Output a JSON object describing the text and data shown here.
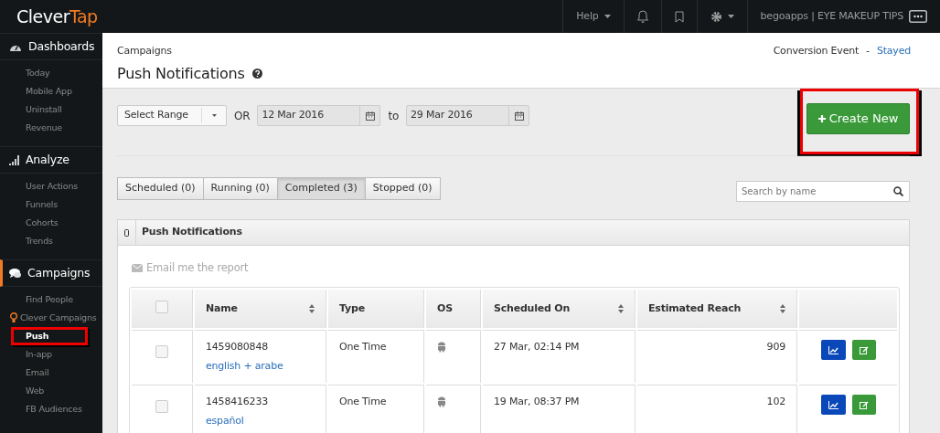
{
  "topbar": {
    "logo_first": "Clever",
    "logo_second": "Tap",
    "help": "Help",
    "account": "begoapps | EYE MAKEUP TIPS"
  },
  "sidebar": {
    "sections": [
      {
        "title": "Dashboards",
        "kind": "dashboard",
        "active": false,
        "items": [
          {
            "label": "Today",
            "kind": "plain",
            "selected": false,
            "highlighted": false
          },
          {
            "label": "Mobile App",
            "kind": "plain",
            "selected": false,
            "highlighted": false
          },
          {
            "label": "Uninstall",
            "kind": "plain",
            "selected": false,
            "highlighted": false
          },
          {
            "label": "Revenue",
            "kind": "plain",
            "selected": false,
            "highlighted": false
          }
        ]
      },
      {
        "title": "Analyze",
        "kind": "signal",
        "active": false,
        "items": [
          {
            "label": "User Actions",
            "kind": "plain",
            "selected": false,
            "highlighted": false
          },
          {
            "label": "Funnels",
            "kind": "plain",
            "selected": false,
            "highlighted": false
          },
          {
            "label": "Cohorts",
            "kind": "plain",
            "selected": false,
            "highlighted": false
          },
          {
            "label": "Trends",
            "kind": "plain",
            "selected": false,
            "highlighted": false
          }
        ]
      },
      {
        "title": "Campaigns",
        "kind": "chat",
        "active": true,
        "items": [
          {
            "label": "Find People",
            "kind": "plain",
            "selected": false,
            "highlighted": false
          },
          {
            "label": "Clever Campaigns",
            "kind": "bulb",
            "selected": false,
            "highlighted": false
          },
          {
            "label": "Push",
            "kind": "plain",
            "selected": true,
            "highlighted": true
          },
          {
            "label": "In-app",
            "kind": "plain",
            "selected": false,
            "highlighted": false
          },
          {
            "label": "Email",
            "kind": "plain",
            "selected": false,
            "highlighted": false
          },
          {
            "label": "Web",
            "kind": "plain",
            "selected": false,
            "highlighted": false
          },
          {
            "label": "FB Audiences",
            "kind": "plain",
            "selected": false,
            "highlighted": false
          }
        ]
      }
    ]
  },
  "header": {
    "breadcrumb": "Campaigns",
    "title": "Push Notifications",
    "conversion_label": "Conversion Event",
    "separator": "-",
    "conversion_value": "Stayed"
  },
  "filters": {
    "range": "Select Range",
    "or_label": "OR",
    "from": "12 Mar 2016",
    "to_label": "to",
    "to": "29 Mar 2016"
  },
  "create_button": {
    "label": "Create New",
    "highlighted": true
  },
  "tabs": [
    {
      "label": "Scheduled (0)",
      "selected": false
    },
    {
      "label": "Running (0)",
      "selected": false
    },
    {
      "label": "Completed (3)",
      "selected": true
    },
    {
      "label": "Stopped (0)",
      "selected": false
    }
  ],
  "search": {
    "placeholder": "Search by name"
  },
  "panel": {
    "title": "Push Notifications",
    "email_link": "Email me the report"
  },
  "table": {
    "select_all_checked": false,
    "columns": [
      {
        "label": "Name",
        "sortable": true
      },
      {
        "label": "Type",
        "sortable": false
      },
      {
        "label": "OS",
        "sortable": false
      },
      {
        "label": "Scheduled On",
        "sortable": true
      },
      {
        "label": "Estimated Reach",
        "sortable": true
      }
    ],
    "rows": [
      {
        "checked": false,
        "name": "1459080848",
        "subtitle": "english + arabe",
        "type": "One Time",
        "kind": "android",
        "scheduled": "27 Mar, 02:14 PM",
        "reach": "909"
      },
      {
        "checked": false,
        "name": "1458416233",
        "subtitle": "español",
        "type": "One Time",
        "kind": "android",
        "scheduled": "19 Mar, 08:37 PM",
        "reach": "102"
      }
    ]
  }
}
